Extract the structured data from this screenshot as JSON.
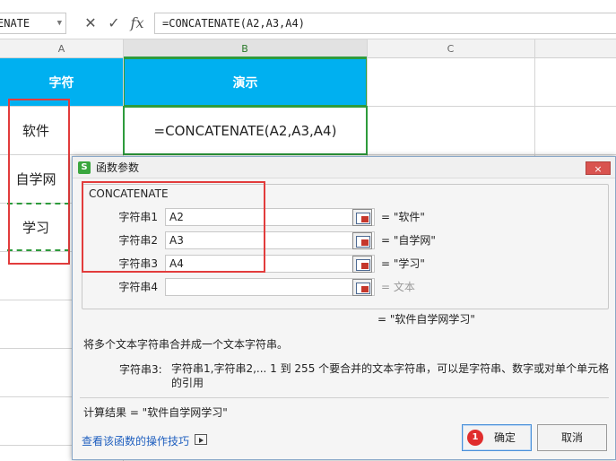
{
  "formula_bar": {
    "name_box": "ENATE",
    "icons": [
      "close-icon",
      "check-icon",
      "fx-icon"
    ],
    "cancel_glyph": "✕",
    "enter_glyph": "✓",
    "fx_label": "fx",
    "formula": "=CONCATENATE(A2,A3,A4)"
  },
  "columns": [
    "A",
    "B",
    "C"
  ],
  "sheet": {
    "header_a": "字符",
    "header_b": "演示",
    "a2": "软件",
    "a3": "自学网",
    "a4": "学习",
    "b2": "=CONCATENATE(A2,A3,A4)"
  },
  "dialog": {
    "title": "函数参数",
    "app_icon_text": "S",
    "close_glyph": "×",
    "function_name": "CONCATENATE",
    "args": [
      {
        "label": "字符串1",
        "value": "A2",
        "result": "= \"软件\""
      },
      {
        "label": "字符串2",
        "value": "A3",
        "result": "= \"自学网\""
      },
      {
        "label": "字符串3",
        "value": "A4",
        "result": "= \"学习\""
      },
      {
        "label": "字符串4",
        "value": "",
        "result": "= 文本"
      }
    ],
    "total_result": "= \"软件自学网学习\"",
    "description": "将多个文本字符串合并成一个文本字符串。",
    "param_label": "字符串3:",
    "param_desc": "字符串1,字符串2,... 1 到 255 个要合并的文本字符串，可以是字符串、数字或对单个单元格的引用",
    "calc_result": "计算结果 = \"软件自学网学习\"",
    "help_link": "查看该函数的操作技巧",
    "ok_label": "确定",
    "cancel_label": "取消",
    "badge": "1"
  },
  "colors": {
    "header_fill": "#00b0f0",
    "annotation_red": "#e23c3c",
    "selection_green": "#2e9b3c"
  }
}
